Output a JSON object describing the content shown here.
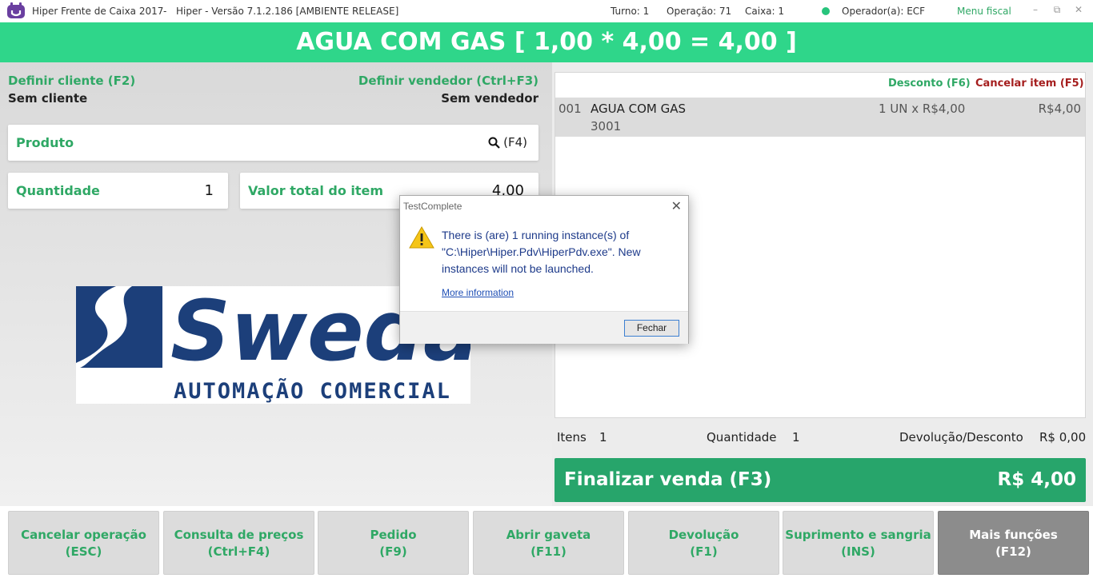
{
  "titlebar": {
    "app_title": "Hiper Frente de Caixa 2017",
    "separator": "-",
    "version": "Hiper - Versão 7.1.2.186 [AMBIENTE RELEASE]",
    "turno_label": "Turno:",
    "turno_value": "1",
    "operacao_label": "Operação:",
    "operacao_value": "71",
    "caixa_label": "Caixa:",
    "caixa_value": "1",
    "operador_label": "Operador(a):",
    "operador_value": "ECF",
    "menu_fiscal": "Menu fiscal",
    "status_color": "#27c47c"
  },
  "product_header": "AGUA COM GAS [ 1,00 * 4,00 = 4,00 ]",
  "left": {
    "cliente_label": "Definir cliente (F2)",
    "cliente_value": "Sem cliente",
    "vendedor_label": "Definir vendedor (Ctrl+F3)",
    "vendedor_value": "Sem vendedor",
    "produto_label": "Produto",
    "produto_shortcut": "(F4)",
    "quantidade_label": "Quantidade",
    "quantidade_value": "1",
    "valor_label": "Valor total do item",
    "valor_value": "4,00",
    "logo_text": "Sweda",
    "logo_subtext": "AUTOMAÇÃO COMERCIAL"
  },
  "cart": {
    "desconto_link": "Desconto (F6)",
    "cancelar_link": "Cancelar item (F5)",
    "items": [
      {
        "num": "001",
        "name": "AGUA COM GAS",
        "code": "3001",
        "qty": "1 UN x R$4,00",
        "total": "R$4,00"
      }
    ]
  },
  "summary": {
    "itens_label": "Itens",
    "itens_value": "1",
    "quantidade_label": "Quantidade",
    "quantidade_value": "1",
    "devolucao_label": "Devolução/Desconto",
    "devolucao_value": "R$ 0,00"
  },
  "finalizar": {
    "label": "Finalizar venda (F3)",
    "amount": "R$ 4,00"
  },
  "function_buttons": [
    {
      "label": "Cancelar operação",
      "key": "(ESC)"
    },
    {
      "label": "Consulta de preços",
      "key": "(Ctrl+F4)"
    },
    {
      "label": "Pedido",
      "key": "(F9)"
    },
    {
      "label": "Abrir gaveta",
      "key": "(F11)"
    },
    {
      "label": "Devolução",
      "key": "(F1)"
    },
    {
      "label": "Suprimento e sangria",
      "key": "(INS)"
    },
    {
      "label": "Mais funções",
      "key": "(F12)"
    }
  ],
  "dialog": {
    "title": "TestComplete",
    "message": "There is (are) 1 running instance(s) of \"C:\\Hiper\\Hiper.Pdv\\HiperPdv.exe\". New instances will not be launched.",
    "more_info": "More information",
    "button": "Fechar"
  },
  "colors": {
    "accent_green": "#2fd68a",
    "finalizar_green": "#27a56b",
    "label_green": "#2fa865",
    "cancel_red": "#a51e1e",
    "sweda_blue": "#1c3f7a"
  }
}
